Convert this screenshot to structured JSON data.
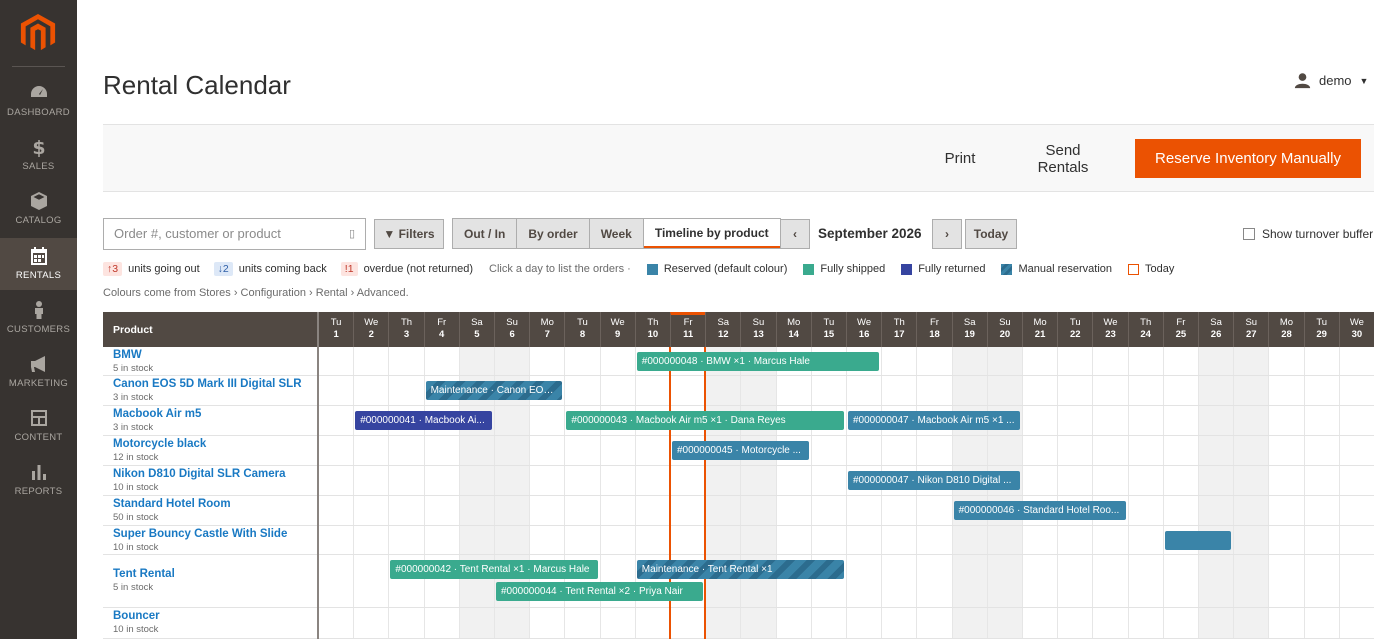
{
  "nav": {
    "items": [
      {
        "label": "DASHBOARD",
        "icon": "dashboard-icon"
      },
      {
        "label": "SALES",
        "icon": "dollar-icon"
      },
      {
        "label": "CATALOG",
        "icon": "box-icon"
      },
      {
        "label": "RENTALS",
        "icon": "calendar-icon",
        "active": true
      },
      {
        "label": "CUSTOMERS",
        "icon": "person-icon"
      },
      {
        "label": "MARKETING",
        "icon": "megaphone-icon"
      },
      {
        "label": "CONTENT",
        "icon": "layout-icon"
      },
      {
        "label": "REPORTS",
        "icon": "bar-chart-icon"
      }
    ]
  },
  "header": {
    "title": "Rental Calendar",
    "user": "demo"
  },
  "actions": {
    "print": "Print",
    "send": "Send Rentals",
    "reserve": "Reserve Inventory Manually"
  },
  "toolbar": {
    "search_placeholder": "Order #, customer or product",
    "clear": "▯",
    "filters": "▼ Filters",
    "views": [
      "Out / In",
      "By order",
      "Week",
      "Timeline by product"
    ],
    "active_view": "Timeline by product",
    "prev": "‹",
    "next": "›",
    "month": "September 2026",
    "today": "Today",
    "turnover": "Show turnover buffer"
  },
  "legend": {
    "out_count": "↑3",
    "out_label": "units going out",
    "in_count": "↓2",
    "in_label": "units coming back",
    "od_count": "!1",
    "od_label": "overdue (not returned)",
    "hint": "Click a day to list the orders ·",
    "reserved": "Reserved (default colour)",
    "shipped": "Fully shipped",
    "returned": "Fully returned",
    "manual": "Manual reservation",
    "today": "Today"
  },
  "colors": {
    "accent": "#eb5202",
    "reserved": "#3a84a8",
    "shipped": "#3aaa8e",
    "returned": "#3644a0",
    "manual": "#2c6c8e"
  },
  "note": "Colours come from Stores › Configuration › Rental › Advanced.",
  "grid": {
    "product_header": "Product",
    "today_day": 11,
    "days": [
      {
        "d": "Tu",
        "n": "1"
      },
      {
        "d": "We",
        "n": "2"
      },
      {
        "d": "Th",
        "n": "3"
      },
      {
        "d": "Fr",
        "n": "4"
      },
      {
        "d": "Sa",
        "n": "5"
      },
      {
        "d": "Su",
        "n": "6"
      },
      {
        "d": "Mo",
        "n": "7"
      },
      {
        "d": "Tu",
        "n": "8"
      },
      {
        "d": "We",
        "n": "9"
      },
      {
        "d": "Th",
        "n": "10"
      },
      {
        "d": "Fr",
        "n": "11"
      },
      {
        "d": "Sa",
        "n": "12"
      },
      {
        "d": "Su",
        "n": "13"
      },
      {
        "d": "Mo",
        "n": "14"
      },
      {
        "d": "Tu",
        "n": "15"
      },
      {
        "d": "We",
        "n": "16"
      },
      {
        "d": "Th",
        "n": "17"
      },
      {
        "d": "Fr",
        "n": "18"
      },
      {
        "d": "Sa",
        "n": "19"
      },
      {
        "d": "Su",
        "n": "20"
      },
      {
        "d": "Mo",
        "n": "21"
      },
      {
        "d": "Tu",
        "n": "22"
      },
      {
        "d": "We",
        "n": "23"
      },
      {
        "d": "Th",
        "n": "24"
      },
      {
        "d": "Fr",
        "n": "25"
      },
      {
        "d": "Sa",
        "n": "26"
      },
      {
        "d": "Su",
        "n": "27"
      },
      {
        "d": "Mo",
        "n": "28"
      },
      {
        "d": "Tu",
        "n": "29"
      },
      {
        "d": "We",
        "n": "30"
      }
    ],
    "rows": [
      {
        "name": "BMW",
        "stock": "5 in stock"
      },
      {
        "name": "Canon EOS 5D Mark III Digital SLR",
        "stock": "3 in stock"
      },
      {
        "name": "Macbook Air m5",
        "stock": "3 in stock"
      },
      {
        "name": "Motorcycle black",
        "stock": "12 in stock"
      },
      {
        "name": "Nikon D810 Digital SLR Camera",
        "stock": "10 in stock"
      },
      {
        "name": "Standard Hotel Room",
        "stock": "50 in stock"
      },
      {
        "name": "Super Bouncy Castle With Slide",
        "stock": "10 in stock"
      },
      {
        "name": "Tent Rental",
        "stock": "5 in stock"
      },
      {
        "name": "Bouncer",
        "stock": "10 in stock"
      }
    ],
    "bars": [
      {
        "row": 0,
        "start": 10,
        "end": 16,
        "type": "shipped",
        "label": "#000000048 · BMW ×1 · Marcus Hale"
      },
      {
        "row": 1,
        "start": 4,
        "end": 7,
        "type": "manual",
        "label": "Maintenance · Canon EOS..."
      },
      {
        "row": 2,
        "start": 2,
        "end": 5,
        "type": "returned",
        "label": "#000000041 · Macbook Ai..."
      },
      {
        "row": 2,
        "start": 8,
        "end": 15,
        "type": "shipped",
        "label": "#000000043 · Macbook Air m5 ×1 · Dana Reyes"
      },
      {
        "row": 2,
        "start": 16,
        "end": 20,
        "type": "reserved",
        "label": "#000000047 · Macbook Air m5 ×1 ..."
      },
      {
        "row": 3,
        "start": 11,
        "end": 14,
        "type": "reserved",
        "label": "#000000045 · Motorcycle ..."
      },
      {
        "row": 4,
        "start": 16,
        "end": 20,
        "type": "reserved",
        "label": "#000000047 · Nikon D810 Digital ..."
      },
      {
        "row": 5,
        "start": 19,
        "end": 23,
        "type": "reserved",
        "label": "#000000046 · Standard Hotel Roo..."
      },
      {
        "row": 6,
        "start": 25,
        "end": 26,
        "type": "reserved",
        "label": ""
      },
      {
        "row": 7,
        "lane": 0,
        "start": 3,
        "end": 8,
        "type": "shipped",
        "label": "#000000042 · Tent Rental ×1 · Marcus Hale"
      },
      {
        "row": 7,
        "lane": 1,
        "start": 6,
        "end": 11,
        "type": "shipped",
        "label": "#000000044 · Tent Rental ×2 · Priya Nair"
      },
      {
        "row": 7,
        "lane": 0,
        "start": 10,
        "end": 15,
        "type": "manual",
        "label": "Maintenance · Tent Rental ×1"
      }
    ]
  }
}
